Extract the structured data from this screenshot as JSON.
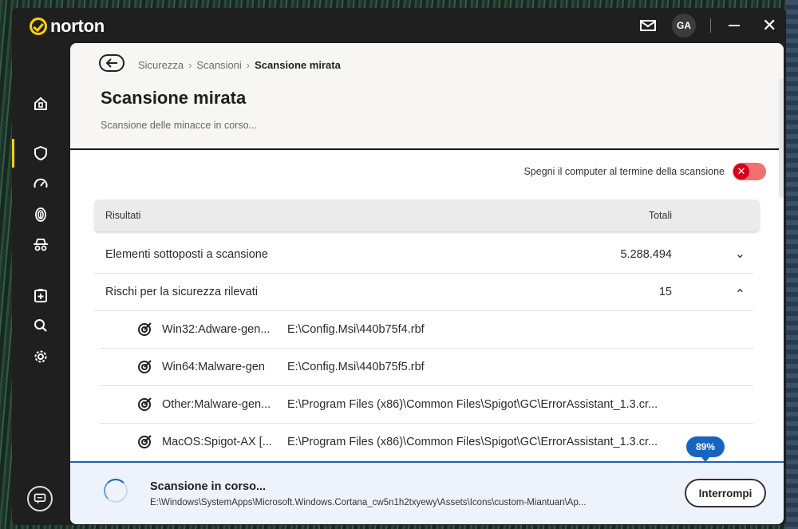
{
  "app": {
    "brand": "norton",
    "user_initials": "GA",
    "brand_color": "#ffd200"
  },
  "sidebar": {
    "items": [
      {
        "name": "home",
        "icon": "home-shield-icon"
      },
      {
        "name": "security",
        "icon": "shield-icon",
        "active": true
      },
      {
        "name": "performance",
        "icon": "speedometer-icon"
      },
      {
        "name": "privacy",
        "icon": "fingerprint-icon"
      },
      {
        "name": "online-privacy",
        "icon": "incognito-icon"
      },
      {
        "name": "add",
        "icon": "plus-clipboard-icon"
      },
      {
        "name": "search",
        "icon": "search-icon"
      },
      {
        "name": "settings",
        "icon": "gear-icon"
      }
    ]
  },
  "header": {
    "breadcrumb": [
      "Sicurezza",
      "Scansioni",
      "Scansione mirata"
    ],
    "title": "Scansione mirata",
    "subtitle": "Scansione delle minacce in corso..."
  },
  "shutdown_toggle": {
    "label": "Spegni il computer al termine della scansione",
    "enabled": false
  },
  "results": {
    "col_results": "Risultati",
    "col_totals": "Totali",
    "rows": [
      {
        "label": "Elementi sottoposti a scansione",
        "value": "5.288.494"
      },
      {
        "label": "Rischi per la sicurezza rilevati",
        "value": "15"
      }
    ],
    "threats": [
      {
        "name": "Win32:Adware-gen...",
        "path": "E:\\Config.Msi\\440b75f4.rbf"
      },
      {
        "name": "Win64:Malware-gen",
        "path": "E:\\Config.Msi\\440b75f5.rbf"
      },
      {
        "name": "Other:Malware-gen...",
        "path": "E:\\Program Files (x86)\\Common Files\\Spigot\\GC\\ErrorAssistant_1.3.cr..."
      },
      {
        "name": "MacOS:Spigot-AX [...",
        "path": "E:\\Program Files (x86)\\Common Files\\Spigot\\GC\\ErrorAssistant_1.3.cr..."
      }
    ]
  },
  "progress": {
    "label": "89%",
    "fraction": 0.89
  },
  "footer": {
    "title": "Scansione in corso...",
    "path": "E:\\Windows\\SystemApps\\Microsoft.Windows.Cortana_cw5n1h2txyewy\\Assets\\Icons\\custom-Miantuan\\Ap...",
    "stop_label": "Interrompi"
  }
}
